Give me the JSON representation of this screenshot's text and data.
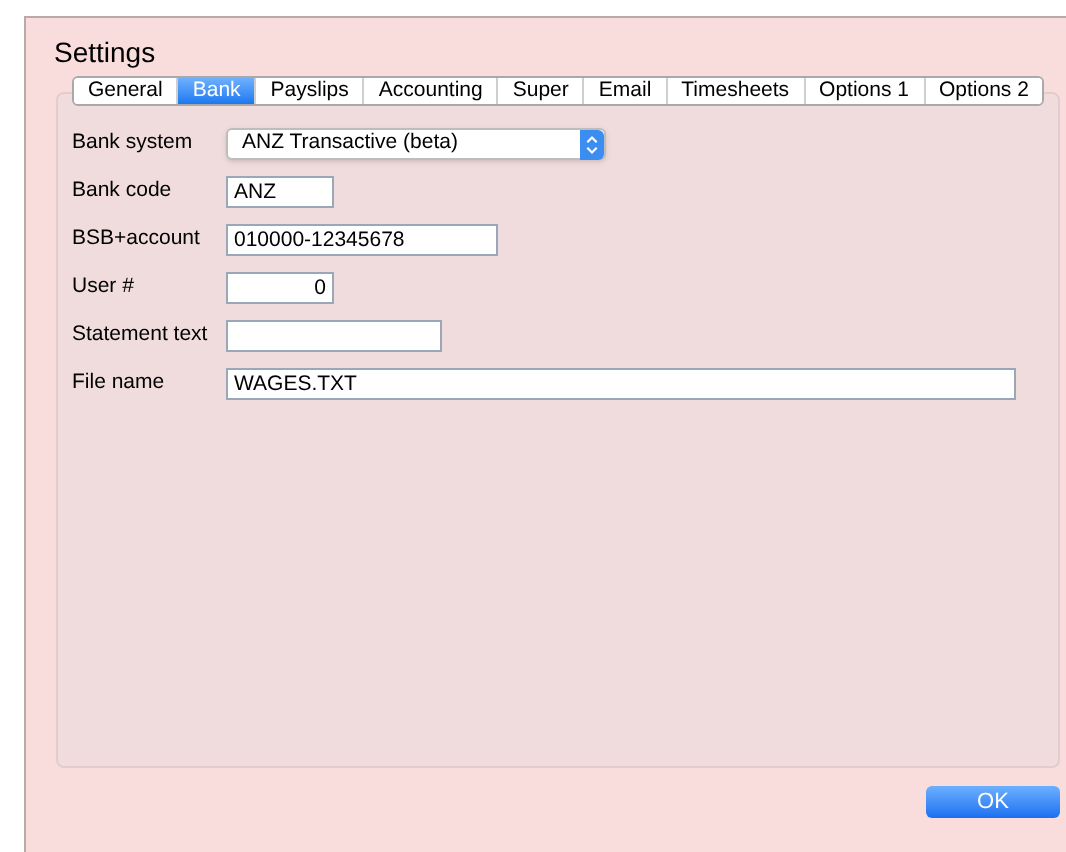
{
  "window": {
    "title": "Settings"
  },
  "tabs": [
    {
      "label": "General",
      "selected": false
    },
    {
      "label": "Bank",
      "selected": true
    },
    {
      "label": "Payslips",
      "selected": false
    },
    {
      "label": "Accounting",
      "selected": false
    },
    {
      "label": "Super",
      "selected": false
    },
    {
      "label": "Email",
      "selected": false
    },
    {
      "label": "Timesheets",
      "selected": false
    },
    {
      "label": "Options 1",
      "selected": false
    },
    {
      "label": "Options 2",
      "selected": false
    }
  ],
  "fields": [
    {
      "label": "Bank system",
      "kind": "select",
      "value": "ANZ Transactive (beta)"
    },
    {
      "label": "Bank code",
      "kind": "text",
      "value": "ANZ"
    },
    {
      "label": "BSB+account",
      "kind": "text",
      "value": "010000-12345678"
    },
    {
      "label": "User #",
      "kind": "number",
      "value": "0"
    },
    {
      "label": "Statement text",
      "kind": "text"
    },
    {
      "label": "File name",
      "kind": "text",
      "value": "WAGES.TXT"
    }
  ],
  "buttons": [
    {
      "label": "OK"
    }
  ]
}
